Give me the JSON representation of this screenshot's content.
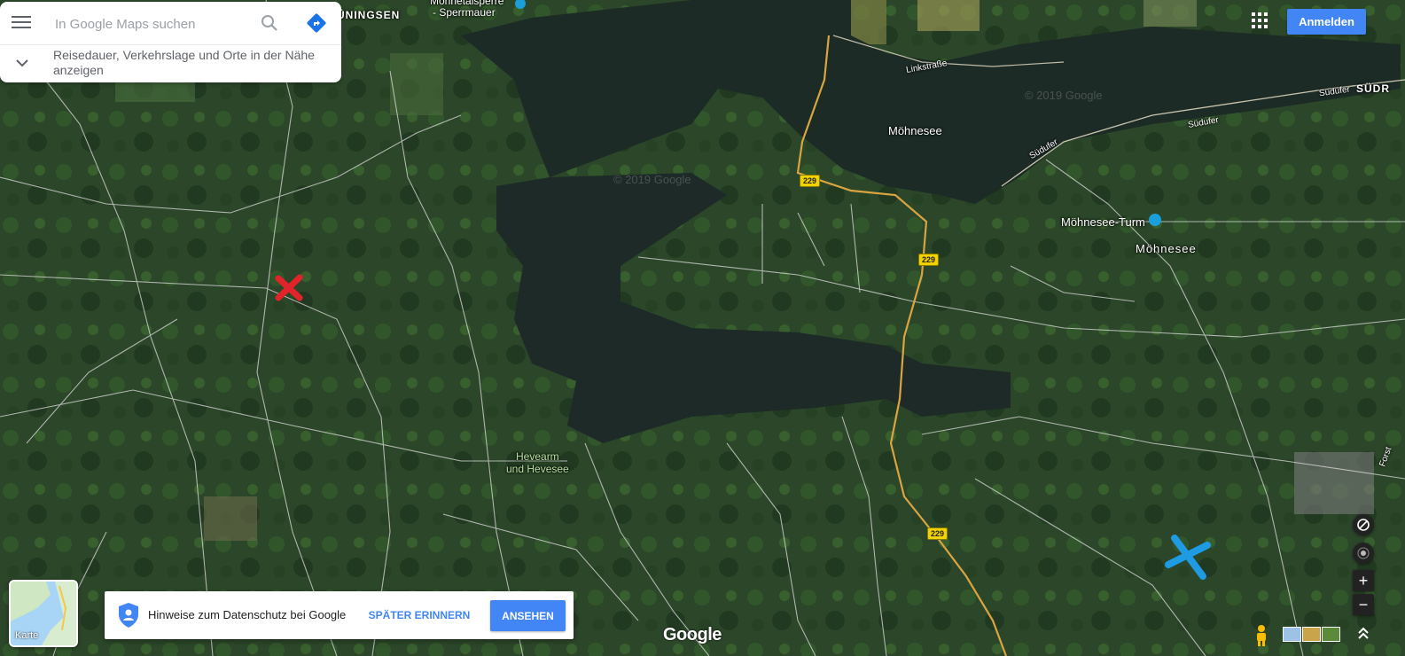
{
  "search": {
    "placeholder": "In Google Maps suchen",
    "suggestion": "Reisedauer, Verkehrslage und Orte in der Nähe anzeigen"
  },
  "top_right": {
    "signin_label": "Anmelden"
  },
  "map_labels": {
    "town_partial_left": "ÜNINGSEN",
    "dam_line1": "Möhnetalsperre",
    "dam_line2": "- Sperrmauer",
    "street_link": "Linkstraße",
    "lake": "Möhnesee",
    "street_suedufer1": "Südufer",
    "street_suedufer2": "Südufer",
    "street_suedufer3": "Südufer",
    "town_right_partial": "SÜDR",
    "tower": "Möhnesee-Turm",
    "town_moehnesee": "Möhnesee",
    "hevearm_line1": "Hevearm",
    "hevearm_line2": "und Hevesee",
    "road_229": "229",
    "forst_partial": "Forst",
    "watermark1": "© 2019 Google",
    "watermark2": "© 2019 Google"
  },
  "layer_switch": {
    "label": "Karte"
  },
  "privacy": {
    "text": "Hinweise zum Datenschutz bei Google",
    "later_label": "SPÄTER ERINNERN",
    "view_label": "ANSEHEN"
  },
  "footer": {
    "google_logo": "Google"
  },
  "controls": {
    "zoom_in": "+",
    "zoom_out": "−"
  },
  "markers": [
    {
      "name": "red-x-marker",
      "color": "#e0242a"
    },
    {
      "name": "blue-x-marker",
      "color": "#1e9be3"
    }
  ],
  "colors": {
    "accent": "#4285f4",
    "lake": "#1d2b26",
    "forest": "#2a4527",
    "road": "#d9a441"
  }
}
